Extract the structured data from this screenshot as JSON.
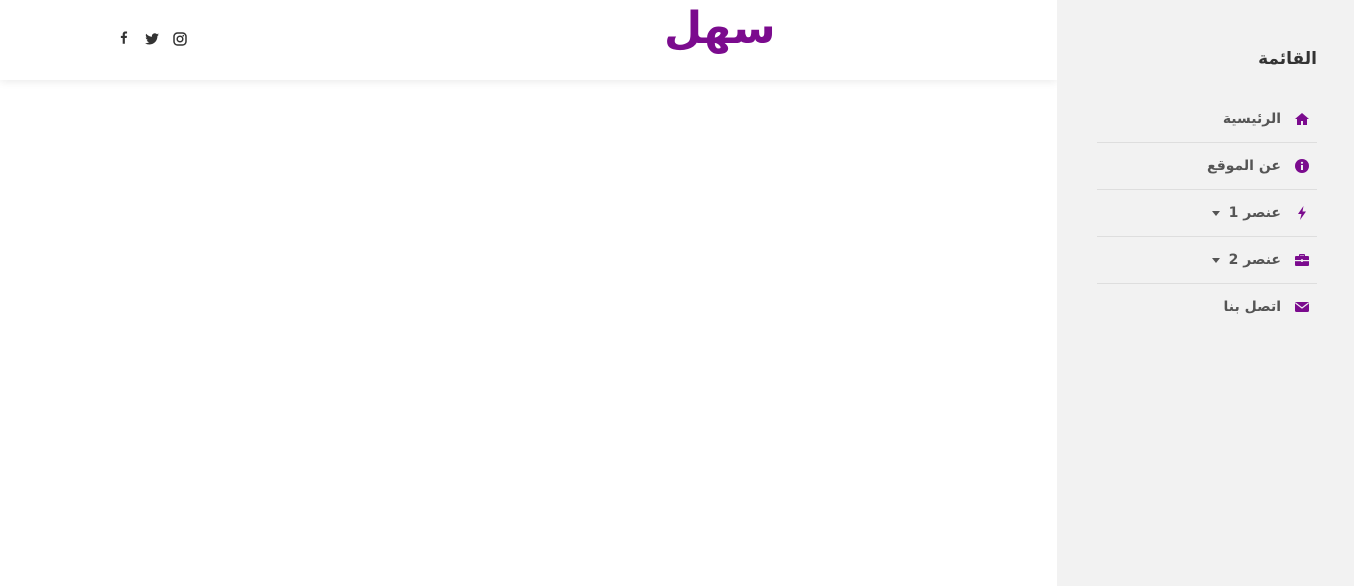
{
  "brand": {
    "logo_text": "سهل",
    "accent": "#7b0b8e"
  },
  "social": [
    {
      "name": "facebook-icon"
    },
    {
      "name": "twitter-icon"
    },
    {
      "name": "instagram-icon"
    }
  ],
  "sidebar": {
    "title": "القائمة",
    "items": [
      {
        "label": "الرئيسية",
        "icon": "home-icon"
      },
      {
        "label": "عن الموقع",
        "icon": "info-circle-icon"
      },
      {
        "label": "عنصر 1",
        "icon": "bolt-icon",
        "dropdown": true
      },
      {
        "label": "عنصر 2",
        "icon": "briefcase-icon",
        "dropdown": true
      },
      {
        "label": "اتصل بنا",
        "icon": "envelope-icon"
      }
    ]
  }
}
